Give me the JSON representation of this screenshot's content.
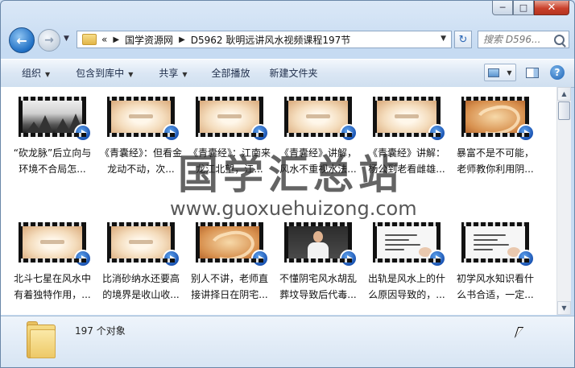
{
  "window": {
    "minimize_glyph": "─",
    "maximize_glyph": "□",
    "close_glyph": "✕"
  },
  "nav": {
    "back_glyph": "←",
    "forward_glyph": "→",
    "path_prefix": "«",
    "path": [
      "国学资源网",
      "D5962 耿明远讲风水视频课程197节"
    ],
    "refresh_glyph": "↻",
    "search_placeholder": "搜索 D596..."
  },
  "toolbar": {
    "organize": "组织",
    "include_in_library": "包含到库中",
    "share": "共享",
    "play_all": "全部播放",
    "new_folder": "新建文件夹"
  },
  "files": [
    {
      "name": "“砍龙脉”后立向与环境不合局怎...",
      "thumb": "ink"
    },
    {
      "name": "《青囊经》：但看金龙动不动，次...",
      "thumb": "scroll"
    },
    {
      "name": "《青囊经》：江南来龙江北望，江...",
      "thumb": "scroll"
    },
    {
      "name": "《青囊经》讲解，风水不重视水法...",
      "thumb": "scroll"
    },
    {
      "name": "《青囊经》讲解：杨公到老看雌雄...",
      "thumb": "scroll"
    },
    {
      "name": "暴富不是不可能，老师教你利用阴...",
      "thumb": "callig"
    },
    {
      "name": "北斗七星在风水中有着独特作用，...",
      "thumb": "scroll"
    },
    {
      "name": "比消砂纳水还要高的境界是收山收...",
      "thumb": "scroll"
    },
    {
      "name": "别人不讲，老师直接讲择日在阴宅...",
      "thumb": "callig"
    },
    {
      "name": "不懂阴宅风水胡乱葬坟导致后代毒...",
      "thumb": "person"
    },
    {
      "name": "出轨是风水上的什么原因导致的，...",
      "thumb": "writing"
    },
    {
      "name": "初学风水知识看什么书合适，一定...",
      "thumb": "writing"
    }
  ],
  "watermark": {
    "cn": "国学汇总站",
    "url": "www.guoxuehuizong.com"
  },
  "details": {
    "count": "197 个对象"
  }
}
